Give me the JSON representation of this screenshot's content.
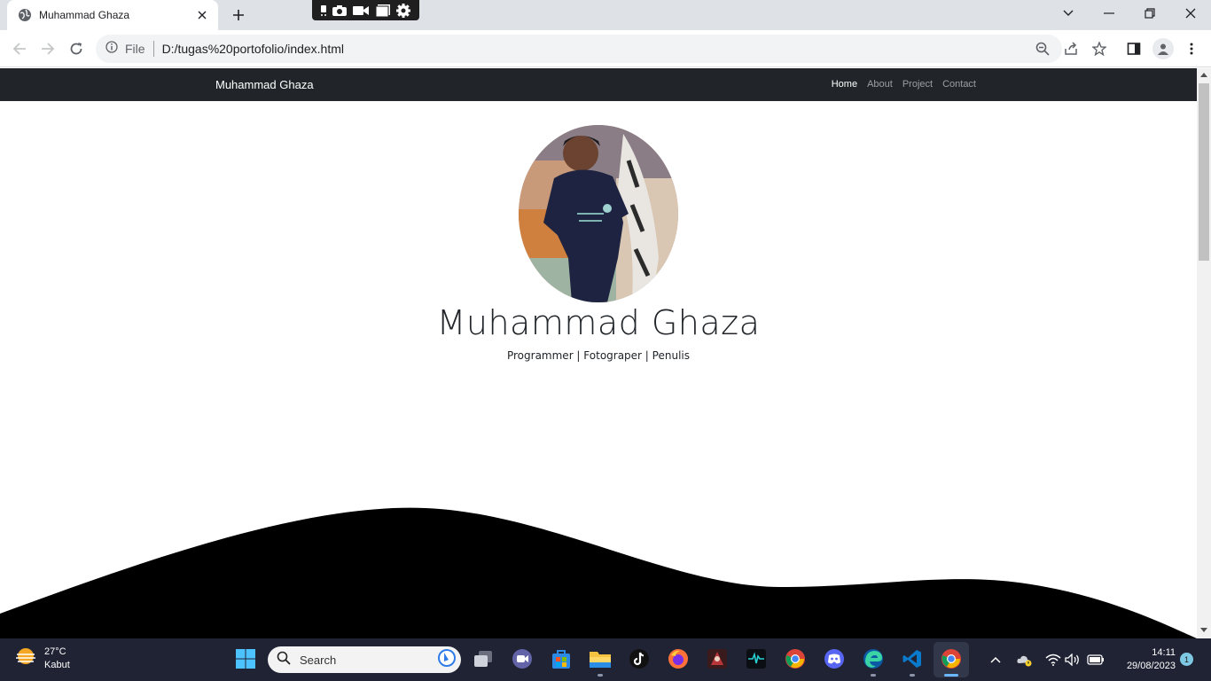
{
  "browser": {
    "tab_title": "Muhammad Ghaza",
    "address_prefix": "File",
    "url": "D:/tugas%20portofolio/index.html"
  },
  "site": {
    "brand": "Muhammad Ghaza",
    "nav": [
      "Home",
      "About",
      "Project",
      "Contact"
    ],
    "active_nav": "Home",
    "hero_name": "Muhammad Ghaza",
    "hero_subtitle": "Programmer | Fotograper | Penulis",
    "wave_color": "#000000",
    "navbar_color": "#212529"
  },
  "taskbar": {
    "weather_temp": "27°C",
    "weather_condition": "Kabut",
    "search_placeholder": "Search",
    "time": "14:11",
    "date": "29/08/2023",
    "notification_count": "1",
    "pinned_apps": [
      "start-icon",
      "search-icon",
      "task-view-icon",
      "teams-icon",
      "store-icon",
      "file-explorer-icon",
      "tiktok-icon",
      "firefox-icon",
      "game-icon",
      "audio-app-icon",
      "chrome-icon",
      "discord-icon",
      "edge-icon",
      "vscode-icon",
      "chrome-icon"
    ]
  }
}
